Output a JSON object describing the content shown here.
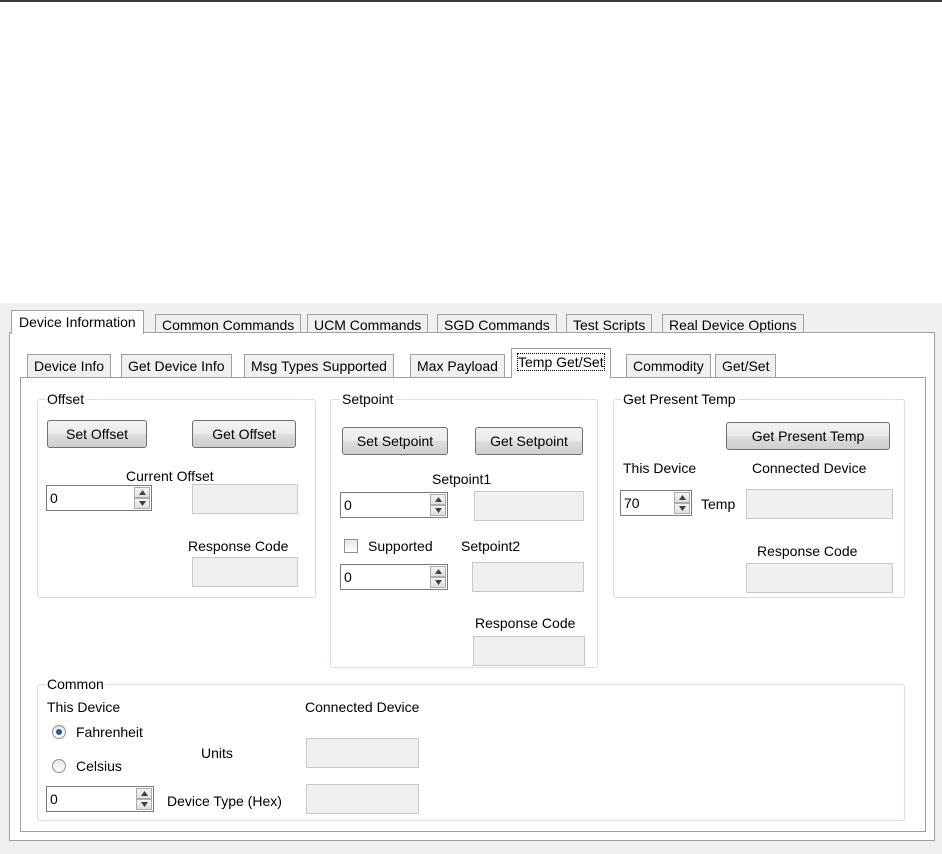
{
  "main_tabs": [
    {
      "label": "Device Information",
      "active": true
    },
    {
      "label": "Common Commands"
    },
    {
      "label": "UCM Commands"
    },
    {
      "label": "SGD Commands"
    },
    {
      "label": "Test Scripts"
    },
    {
      "label": "Real Device Options"
    }
  ],
  "sub_tabs": [
    {
      "label": "Device Info"
    },
    {
      "label": "Get Device Info"
    },
    {
      "label": "Msg Types Supported"
    },
    {
      "label": "Max Payload"
    },
    {
      "label": "Temp Get/Set",
      "active": true
    },
    {
      "label": "Commodity"
    },
    {
      "label": "Get/Set"
    }
  ],
  "offset": {
    "title": "Offset",
    "set_button": "Set Offset",
    "get_button": "Get Offset",
    "current_label": "Current Offset",
    "value": "0",
    "response_label": "Response Code"
  },
  "setpoint": {
    "title": "Setpoint",
    "set_button": "Set Setpoint",
    "get_button": "Get Setpoint",
    "setpoint1_label": "Setpoint1",
    "setpoint1_value": "0",
    "supported_label": "Supported",
    "supported_checked": false,
    "setpoint2_label": "Setpoint2",
    "setpoint2_value": "0",
    "response_label": "Response Code"
  },
  "present_temp": {
    "title": "Get Present Temp",
    "get_button": "Get Present Temp",
    "this_device_label": "This Device",
    "connected_label": "Connected Device",
    "value": "70",
    "temp_label": "Temp",
    "response_label": "Response Code"
  },
  "common": {
    "title": "Common",
    "this_device_label": "This Device",
    "connected_label": "Connected Device",
    "fahrenheit_label": "Fahrenheit",
    "celsius_label": "Celsius",
    "selected_unit": "Fahrenheit",
    "units_label": "Units",
    "device_type_label": "Device Type (Hex)",
    "device_type_value": "0"
  },
  "colors": {
    "tab_border": "#a0a0a0",
    "group_border": "#d5dfe5",
    "radio_dot": "#1c5ea8"
  }
}
